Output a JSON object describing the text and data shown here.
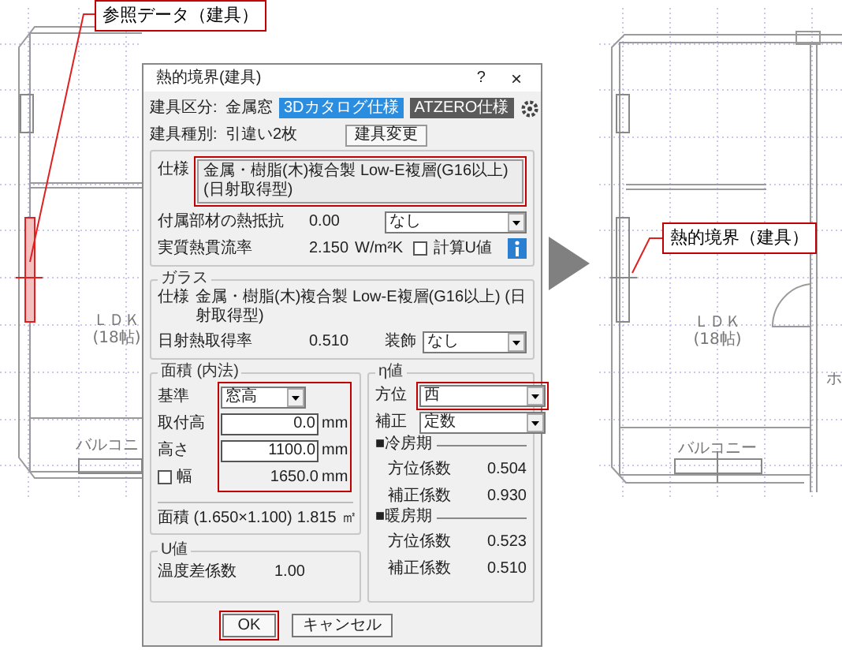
{
  "floor_plans": [
    {
      "window_selected": true,
      "labels": [
        "ＬＤＫ",
        "(18帖)",
        "バルコニ"
      ]
    },
    {
      "window_selected": false,
      "labels": [
        "ＬＤＫ",
        "(18帖)",
        "バルコニー",
        "ホ"
      ]
    }
  ],
  "callouts": [
    "参照データ（建具）",
    "熱的境界（建具）"
  ],
  "dialog": {
    "title": "熱的境界(建具)",
    "help": "?",
    "close": "×",
    "fields": [
      {
        "label": "建具区分:",
        "value": "金属窓"
      },
      {
        "label": "建具種別:",
        "value": "引違い2枚"
      }
    ],
    "spec_buttons": [
      {
        "label": "3Dカタログ仕様",
        "selected": true
      },
      {
        "label": "ATZERO仕様",
        "selected": false
      }
    ],
    "change_button": "建具変更",
    "spec": {
      "label": "仕様",
      "button": "金属・樹脂(木)複合製 Low-E複層(G16以上) (日射取得型)",
      "highlighted": true
    },
    "accessory": {
      "label": "付属部材の熱抵抗",
      "value": "0.00",
      "select": "なし"
    },
    "u_value": {
      "label": "実質熱貫流率",
      "value": "2.150",
      "unit": "W/m²K",
      "checkbox": {
        "label": "計算U値",
        "checked": false
      }
    },
    "glass": {
      "title": "ガラス",
      "spec_label": "仕様",
      "spec": "金属・樹脂(木)複合製 Low-E複層(G16以上) (日射取得型)",
      "label": "日射熱取得率",
      "value": "0.510",
      "decor_label": "装飾",
      "decor": "なし"
    },
    "area": {
      "title": "面積 (内法)",
      "highlighted": true,
      "rows": [
        {
          "kind": "select",
          "label": "基準",
          "value": "窓高"
        },
        {
          "kind": "input",
          "label": "取付高",
          "value": "0.0",
          "unit": "mm"
        },
        {
          "kind": "input",
          "label": "高さ",
          "value": "1100.0",
          "unit": "mm"
        },
        {
          "kind": "check",
          "label": "幅",
          "checked": false,
          "value": "1650.0",
          "unit": "mm"
        }
      ],
      "total_label": "面積 (1.650×1.100)",
      "total": "1.815",
      "total_unit": "㎡"
    },
    "u": {
      "title": "U値",
      "label": "温度差係数",
      "value": "1.00"
    },
    "eta": {
      "title": "η値",
      "rows": [
        {
          "label": "方位",
          "value": "西",
          "highlighted": true
        },
        {
          "label": "補正",
          "value": "定数",
          "highlighted": false
        }
      ],
      "periods": [
        {
          "title": "■冷房期",
          "rows": [
            {
              "label": "方位係数",
              "value": "0.504"
            },
            {
              "label": "補正係数",
              "value": "0.930"
            }
          ]
        },
        {
          "title": "■暖房期",
          "rows": [
            {
              "label": "方位係数",
              "value": "0.523"
            },
            {
              "label": "補正係数",
              "value": "0.510"
            }
          ]
        }
      ]
    },
    "buttons": [
      {
        "label": "OK",
        "highlighted": true
      },
      {
        "label": "キャンセル",
        "highlighted": false
      }
    ]
  }
}
